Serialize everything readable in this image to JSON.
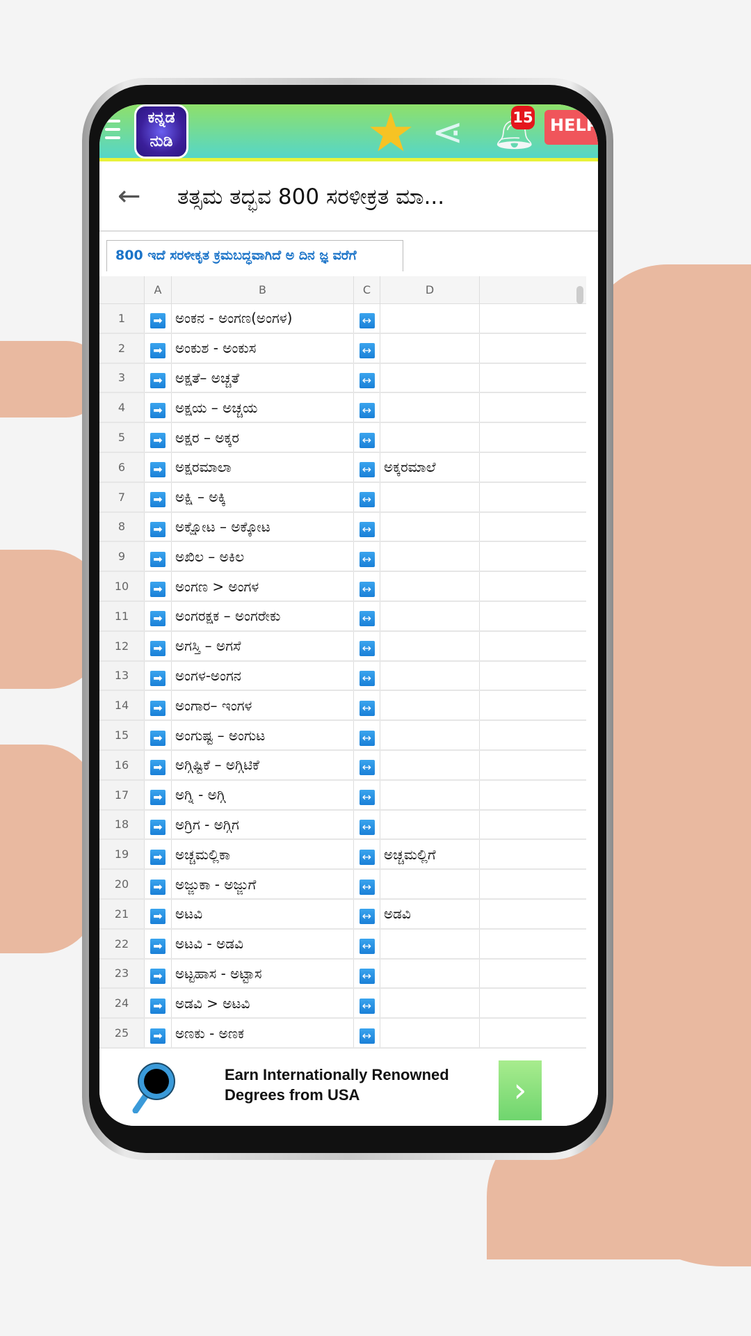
{
  "app": {
    "logo_text": [
      "ಕನ್ನಡ",
      "ನುಡಿ"
    ],
    "notification_count": "15",
    "help_label": "HELP"
  },
  "header": {
    "title": "ತತ್ಸಮ ತದ್ಭವ 800 ಸರಳೀಕ್ರತ ಮಾ..."
  },
  "tab": {
    "label": "800 ಇದೆ ಸರಳೀಕೃತ ಕ್ರಮಬದ್ಧವಾಗಿದೆ ಅ ದಿನ ಜ್ಞ ವರೆಗೆ"
  },
  "columns": [
    "A",
    "B",
    "C",
    "D"
  ],
  "rows": [
    {
      "n": "1",
      "b": "ಅಂಕನ - ಅಂಗಣ(ಅಂಗಳ)",
      "d": ""
    },
    {
      "n": "2",
      "b": "ಅಂಕುಶ - ಅಂಕುಸ",
      "d": ""
    },
    {
      "n": "3",
      "b": "ಅಕ್ಷತೆ– ಅಚ್ಚತೆ",
      "d": ""
    },
    {
      "n": "4",
      "b": "ಅಕ್ಷಯ – ಅಚ್ಚಯ",
      "d": ""
    },
    {
      "n": "5",
      "b": "ಅಕ್ಷರ – ಅಕ್ಕರ",
      "d": ""
    },
    {
      "n": "6",
      "b": "ಅಕ್ಷರಮಾಲಾ",
      "d": "ಅಕ್ಕರಮಾಲೆ"
    },
    {
      "n": "7",
      "b": "ಅಕ್ಷಿ – ಅಕ್ಕಿ",
      "d": ""
    },
    {
      "n": "8",
      "b": "ಅಕ್ಷೋಟ – ಅಕ್ಕೋಟ",
      "d": ""
    },
    {
      "n": "9",
      "b": "ಅಖಿಲ – ಅಕಿಲ",
      "d": ""
    },
    {
      "n": "10",
      "b": "ಅಂಗಣ > ಅಂಗಳ",
      "d": ""
    },
    {
      "n": "11",
      "b": "ಅಂಗರಕ್ಷಕ – ಅಂಗರೇಕು",
      "d": ""
    },
    {
      "n": "12",
      "b": "ಅಗಸ್ತಿ – ಅಗಸೆ",
      "d": ""
    },
    {
      "n": "13",
      "b": "ಅಂಗಳ-ಅಂಗನ",
      "d": ""
    },
    {
      "n": "14",
      "b": "ಅಂಗಾರ– ಇಂಗಳ",
      "d": ""
    },
    {
      "n": "15",
      "b": "ಅಂಗುಷ್ಟ – ಅಂಗುಟ",
      "d": ""
    },
    {
      "n": "16",
      "b": "ಅಗ್ಗಿಷ್ಟಿಕೆ – ಅಗ್ಗಿಟಿಕೆ",
      "d": ""
    },
    {
      "n": "17",
      "b": "ಅಗ್ನಿ - ಅಗ್ಗಿ",
      "d": ""
    },
    {
      "n": "18",
      "b": "ಅಗ್ರಿಗ - ಅಗ್ಗಿಗ",
      "d": ""
    },
    {
      "n": "19",
      "b": "ಅಚ್ಚಮಲ್ಲಿಕಾ",
      "d": "ಅಚ್ಚಮಲ್ಲಿಗೆ"
    },
    {
      "n": "20",
      "b": "ಅಜ್ಜುಕಾ - ಅಜ್ಜುಗೆ",
      "d": ""
    },
    {
      "n": "21",
      "b": "ಅಟವಿ",
      "d": "ಅಡವಿ"
    },
    {
      "n": "22",
      "b": "ಅಟವಿ - ಅಡವಿ",
      "d": ""
    },
    {
      "n": "23",
      "b": "ಅಟ್ಟಹಾಸ - ಅಟ್ಟಾಸ",
      "d": ""
    },
    {
      "n": "24",
      "b": "ಅಡವಿ > ಅಟವಿ",
      "d": ""
    },
    {
      "n": "25",
      "b": "ಅಣಕು - ಅಣಕ",
      "d": ""
    }
  ],
  "ad": {
    "line1": "Earn Internationally Renowned",
    "line2": "Degrees from USA"
  },
  "colors": {
    "link_blue": "#1a73c8",
    "icon_blue": "#1a80d8",
    "badge_red": "#e4161c",
    "star": "#f6c324"
  }
}
